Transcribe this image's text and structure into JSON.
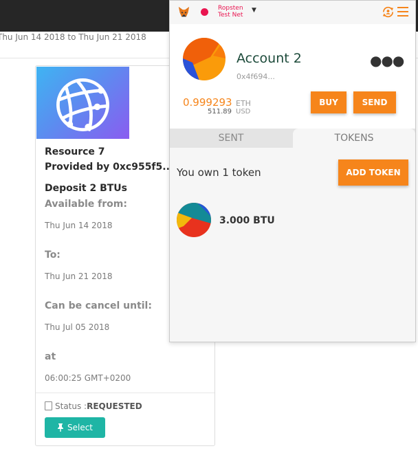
{
  "page": {
    "date_range": "Thu Jun 14 2018 to Thu Jun 21 2018"
  },
  "card": {
    "title": "Resource 7",
    "provider": "Provided by 0xc955f5...",
    "deposit": "Deposit 2 BTUs",
    "available_label": "Available from:",
    "available_value": "Thu Jun 14 2018",
    "to_label": "To:",
    "to_value": "Thu Jun 21 2018",
    "cancel_label": "Can be cancel until:",
    "cancel_value": "Thu Jul 05 2018",
    "at_label": "at",
    "at_value": "06:00:25 GMT+0200",
    "status_label": "Status :",
    "status_value": "REQUESTED",
    "select_label": "Select"
  },
  "metamask": {
    "network_line1": "Ropsten",
    "network_line2": "Test Net",
    "account_name": "Account 2",
    "account_address": "0x4f694...",
    "eth_amount": "0.999293",
    "eth_unit": "ETH",
    "usd_amount": "511.89",
    "usd_unit": "USD",
    "buy_label": "BUY",
    "send_label": "SEND",
    "tab_sent": "SENT",
    "tab_tokens": "TOKENS",
    "tokens_owned_text": "You own 1 token",
    "add_token_label": "ADD TOKEN",
    "token_amount": "3.000 BTU"
  },
  "colors": {
    "accent": "#f6851b",
    "network": "#e91550",
    "select_button": "#1fb5a5",
    "topbar": "#262626"
  },
  "icons": {
    "logo": "globe-network-icon",
    "fox": "metamask-fox-icon",
    "sync": "account-sync-icon",
    "menu": "hamburger-menu-icon",
    "status": "id-badge-icon",
    "select": "pin-icon"
  }
}
